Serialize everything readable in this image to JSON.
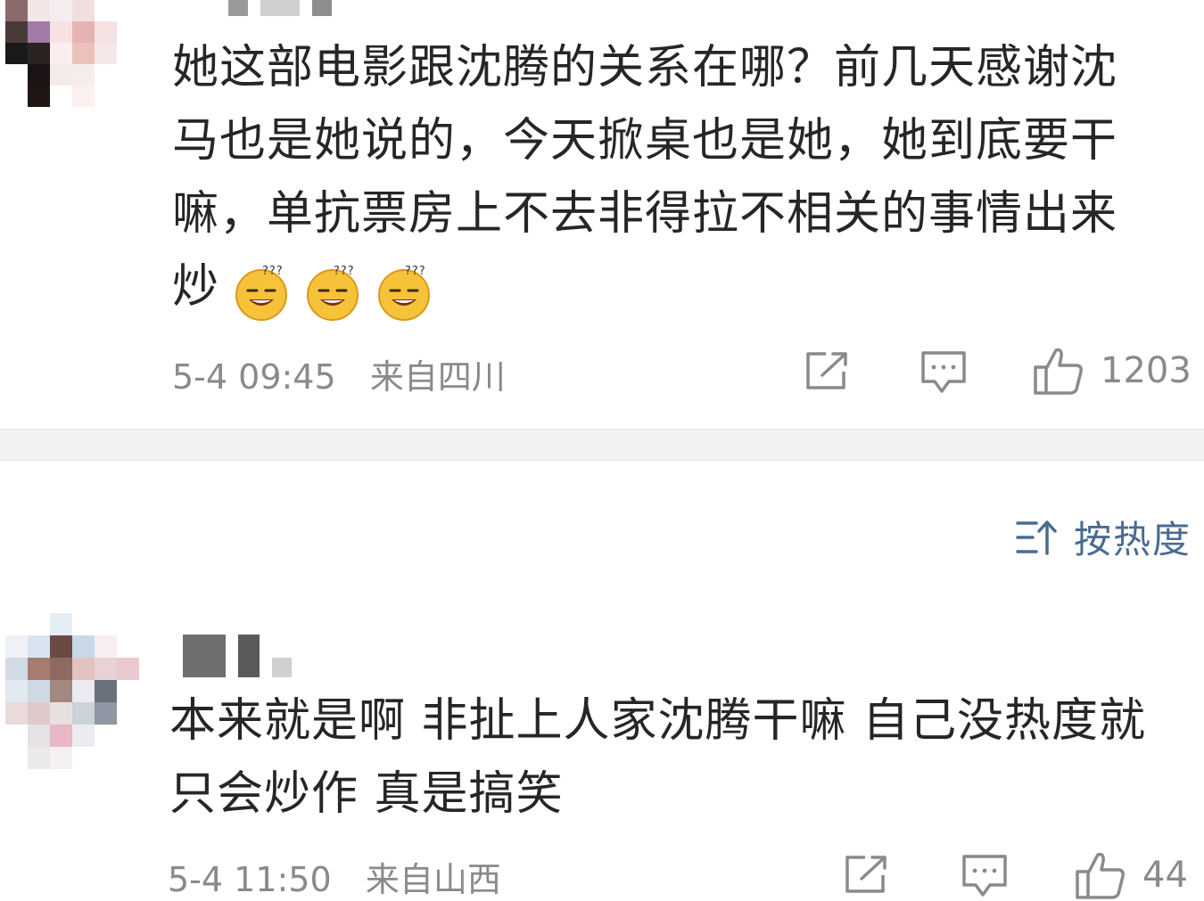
{
  "comments": [
    {
      "text": "她这部电影跟沈腾的关系在哪？前几天感谢沈马也是她说的，今天掀桌也是她，她到底要干嘛，单抗票房上不去非得拉不相关的事情出来炒",
      "emojis": [
        "sweat-smile-emoji",
        "sweat-smile-emoji",
        "sweat-smile-emoji"
      ],
      "time": "5-4 09:45",
      "location": "来自四川",
      "likes": "1203"
    },
    {
      "text": "本来就是啊 非扯上人家沈腾干嘛 自己没热度就只会炒作 真是搞笑",
      "time": "5-4 11:50",
      "location": "来自山西",
      "likes": "44"
    }
  ],
  "sort": {
    "label": "按热度"
  },
  "colors": {
    "accent": "#4a6b91",
    "meta": "#8a8a8a",
    "divider": "#f2f2f2"
  }
}
